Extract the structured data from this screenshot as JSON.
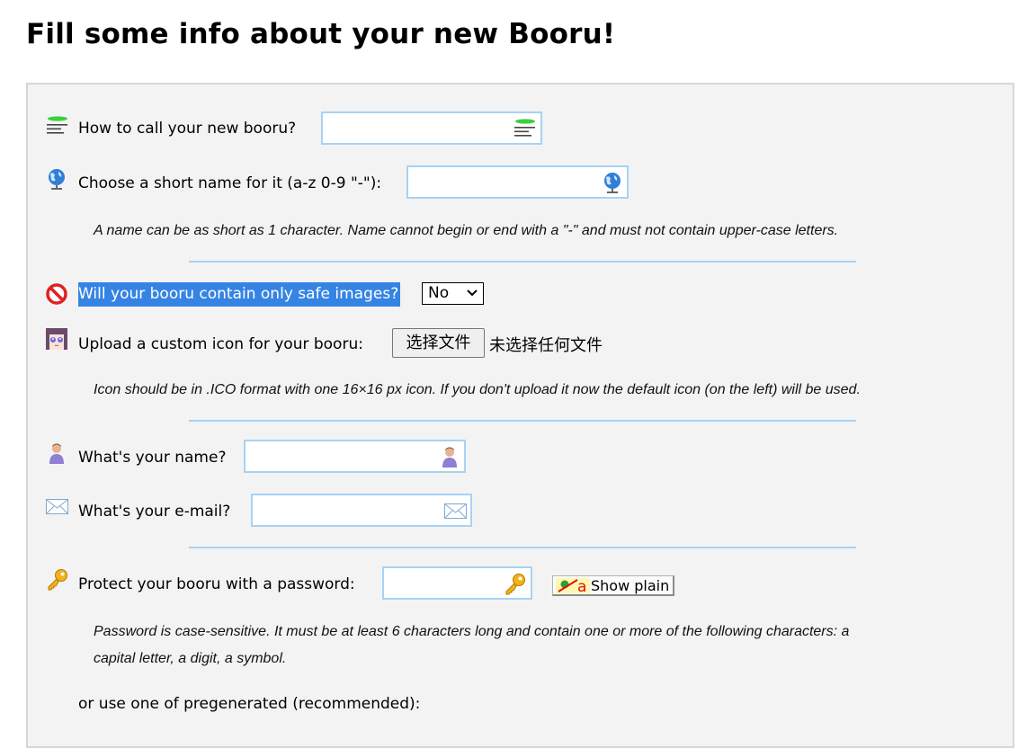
{
  "page": {
    "title": "Fill some info about your new Booru!"
  },
  "form": {
    "booru_title": {
      "label": "How to call your new booru?",
      "value": "",
      "icon": "text-lines-icon"
    },
    "short_name": {
      "label": "Choose a short name for it (a-z 0-9 \"-\"):",
      "value": "",
      "icon": "globe-icon",
      "hint": "A name can be as short as 1 character. Name cannot begin or end with a \"-\" and must not contain upper-case letters."
    },
    "safe_images": {
      "label": "Will your booru contain only safe images?",
      "selected": "No",
      "icon": "no-entry-icon"
    },
    "custom_icon": {
      "label": "Upload a custom icon for your booru:",
      "button_label": "选择文件",
      "status": "未选择任何文件",
      "icon": "anime-face-icon",
      "hint": "Icon should be in .ICO format with one 16×16 px icon. If you don't upload it now the default icon (on the left) will be used."
    },
    "owner_name": {
      "label": "What's your name?",
      "value": "",
      "icon": "user-icon"
    },
    "email": {
      "label": "What's your e-mail?",
      "value": "",
      "icon": "envelope-icon"
    },
    "password": {
      "label": "Protect your booru with a password:",
      "value": "",
      "icon": "key-icon",
      "show_plain_label": "Show plain",
      "hint_line1": "Password is case-sensitive. It must be at least 6 characters long and contain one or more of the following characters: a",
      "hint_line2": "capital letter, a digit, a symbol.",
      "pregenerated_label": "or use one of pregenerated (recommended):"
    }
  },
  "colors": {
    "panel_bg": "#f3f3f3",
    "field_border": "#a7d2f5",
    "selection_highlight": "#3584e4"
  }
}
